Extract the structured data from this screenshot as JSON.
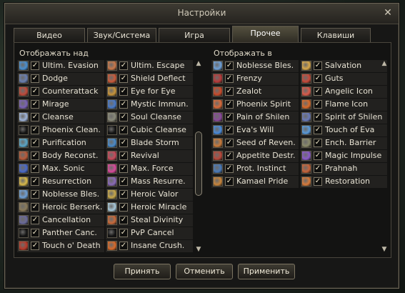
{
  "window": {
    "title": "Настройки",
    "close_icon": "close-icon"
  },
  "tabs": [
    {
      "label": "Видео",
      "active": false
    },
    {
      "label": "Звук/Система",
      "active": false
    },
    {
      "label": "Игра",
      "active": false
    },
    {
      "label": "Прочее",
      "active": true
    },
    {
      "label": "Клавиши",
      "active": false
    }
  ],
  "left_section": {
    "header": "Отображать над",
    "col1": [
      {
        "label": "Ultim. Evasion",
        "icon": "ultim-evasion-icon",
        "checked": true,
        "color": "#4a8fd0"
      },
      {
        "label": "Dodge",
        "icon": "dodge-icon",
        "checked": true,
        "color": "#6a7fb0"
      },
      {
        "label": "Counterattack",
        "icon": "counterattack-icon",
        "checked": true,
        "color": "#c04a3a"
      },
      {
        "label": "Mirage",
        "icon": "mirage-icon",
        "checked": true,
        "color": "#7a62b4"
      },
      {
        "label": "Cleanse",
        "icon": "cleanse-icon",
        "checked": true,
        "color": "#9fb4d8"
      },
      {
        "label": "Phoenix Clean.",
        "icon": "phoenix-cleanse-icon",
        "checked": true,
        "color": "#141414"
      },
      {
        "label": "Purification",
        "icon": "purification-icon",
        "checked": true,
        "color": "#5aa6c8"
      },
      {
        "label": "Body Reconst.",
        "icon": "body-reconstruction-icon",
        "checked": true,
        "color": "#b85a3a"
      },
      {
        "label": "Max. Sonic",
        "icon": "max-sonic-icon",
        "checked": true,
        "color": "#4a6ac8"
      },
      {
        "label": "Resurrection",
        "icon": "resurrection-icon",
        "checked": true,
        "color": "#d8b84a"
      },
      {
        "label": "Noblesse Bles.",
        "icon": "noblesse-blessing-icon",
        "checked": true,
        "color": "#6fa0d6"
      },
      {
        "label": "Heroic Berserk.",
        "icon": "heroic-berserker-icon",
        "checked": true,
        "color": "#8a7a5a"
      },
      {
        "label": "Cancellation",
        "icon": "cancellation-icon",
        "checked": true,
        "color": "#6a6a9a"
      },
      {
        "label": "Panther Canc.",
        "icon": "panther-cancel-icon",
        "checked": true,
        "color": "#141414"
      },
      {
        "label": "Touch o' Death",
        "icon": "touch-of-death-icon",
        "checked": true,
        "color": "#b83a2a"
      }
    ],
    "col2": [
      {
        "label": "Ultim. Escape",
        "icon": "ultim-escape-icon",
        "checked": true,
        "color": "#c8784a"
      },
      {
        "label": "Shield Deflect",
        "icon": "shield-deflect-icon",
        "checked": true,
        "color": "#c85a3a"
      },
      {
        "label": "Eye for Eye",
        "icon": "eye-for-eye-icon",
        "checked": true,
        "color": "#c8943a"
      },
      {
        "label": "Mystic Immun.",
        "icon": "mystic-immunity-icon",
        "checked": true,
        "color": "#4a7ac8"
      },
      {
        "label": "Soul Cleanse",
        "icon": "soul-cleanse-icon",
        "checked": true,
        "color": "#8a8a7a"
      },
      {
        "label": "Cubic Cleanse",
        "icon": "cubic-cleanse-icon",
        "checked": true,
        "color": "#141414"
      },
      {
        "label": "Blade Storm",
        "icon": "blade-storm-icon",
        "checked": true,
        "color": "#4a8ac8"
      },
      {
        "label": "Revival",
        "icon": "revival-icon",
        "checked": true,
        "color": "#c84a5a"
      },
      {
        "label": "Max. Force",
        "icon": "max-force-icon",
        "checked": true,
        "color": "#d84a9a"
      },
      {
        "label": "Mass Resurre.",
        "icon": "mass-resurrection-icon",
        "checked": true,
        "color": "#8a6ab8"
      },
      {
        "label": "Heroic Valor",
        "icon": "heroic-valor-icon",
        "checked": true,
        "color": "#c8a84a"
      },
      {
        "label": "Heroic Miracle",
        "icon": "heroic-miracle-icon",
        "checked": true,
        "color": "#a8c8d8"
      },
      {
        "label": "Steal Divinity",
        "icon": "steal-divinity-icon",
        "checked": true,
        "color": "#c86a3a"
      },
      {
        "label": "PvP Cancel",
        "icon": "pvp-cancel-icon",
        "checked": true,
        "color": "#141414"
      },
      {
        "label": "Insane Crush.",
        "icon": "insane-crusher-icon",
        "checked": true,
        "color": "#d86a2a"
      }
    ]
  },
  "right_section": {
    "header": "Отображать в",
    "col1": [
      {
        "label": "Noblesse Bles.",
        "icon": "noblesse-blessing-icon",
        "checked": true,
        "color": "#6fa0d6"
      },
      {
        "label": "Frenzy",
        "icon": "frenzy-icon",
        "checked": true,
        "color": "#b83a3a"
      },
      {
        "label": "Zealot",
        "icon": "zealot-icon",
        "checked": true,
        "color": "#c84a2a"
      },
      {
        "label": "Phoenix Spirit",
        "icon": "phoenix-spirit-icon",
        "checked": true,
        "color": "#d86a3a"
      },
      {
        "label": "Pain of Shilen",
        "icon": "pain-of-shilen-icon",
        "checked": true,
        "color": "#8a4a9a"
      },
      {
        "label": "Eva's Will",
        "icon": "evas-will-icon",
        "checked": true,
        "color": "#4a8ad8"
      },
      {
        "label": "Seed of Reven.",
        "icon": "seed-of-revenge-icon",
        "checked": true,
        "color": "#c87a3a"
      },
      {
        "label": "Appetite Destr.",
        "icon": "appetite-destruction-icon",
        "checked": true,
        "color": "#b8483a"
      },
      {
        "label": "Prot. Instinct",
        "icon": "protection-instinct-icon",
        "checked": true,
        "color": "#4a7ab8"
      },
      {
        "label": "Kamael Pride",
        "icon": "kamael-pride-icon",
        "checked": true,
        "color": "#c8843a"
      }
    ],
    "col2": [
      {
        "label": "Salvation",
        "icon": "salvation-icon",
        "checked": true,
        "color": "#d8a84a"
      },
      {
        "label": "Guts",
        "icon": "guts-icon",
        "checked": true,
        "color": "#c84a3a"
      },
      {
        "label": "Angelic Icon",
        "icon": "angelic-icon-icon",
        "checked": true,
        "color": "#d85a4a"
      },
      {
        "label": "Flame Icon",
        "icon": "flame-icon-icon",
        "checked": true,
        "color": "#d86a2a"
      },
      {
        "label": "Spirit of Shilen",
        "icon": "spirit-of-shilen-icon",
        "checked": true,
        "color": "#6a7ab8"
      },
      {
        "label": "Touch of Eva",
        "icon": "touch-of-eva-icon",
        "checked": true,
        "color": "#5a9ad8"
      },
      {
        "label": "Ench. Barrier",
        "icon": "enchanted-barrier-icon",
        "checked": true,
        "color": "#8a8a6a"
      },
      {
        "label": "Magic Impulse",
        "icon": "magic-impulse-icon",
        "checked": true,
        "color": "#8a5ac8"
      },
      {
        "label": "Prahnah",
        "icon": "prahnah-icon",
        "checked": true,
        "color": "#c8643a"
      },
      {
        "label": "Restoration",
        "icon": "restoration-icon",
        "checked": true,
        "color": "#d87a3a"
      }
    ]
  },
  "buttons": {
    "accept": "Принять",
    "cancel": "Отменить",
    "apply": "Применить"
  }
}
